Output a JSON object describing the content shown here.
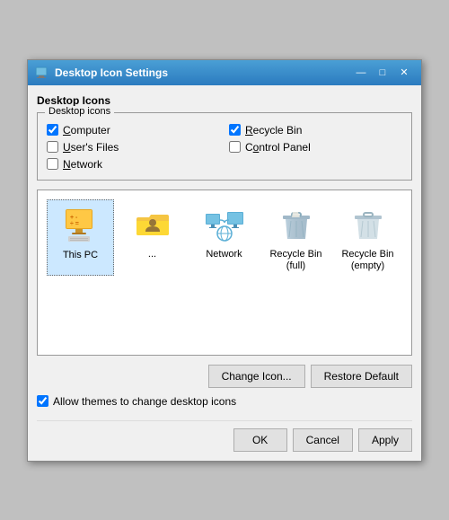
{
  "window": {
    "title": "Desktop Icon Settings",
    "titlebar_icon": "🖥️"
  },
  "section": {
    "label": "Desktop Icons",
    "group_title": "Desktop icons",
    "checkboxes": [
      {
        "id": "cb-computer",
        "label": "Computer",
        "underline_char": "C",
        "checked": true,
        "col": 1
      },
      {
        "id": "cb-recycle",
        "label": "Recycle Bin",
        "underline_char": "R",
        "checked": true,
        "col": 2
      },
      {
        "id": "cb-userfiles",
        "label": "User's Files",
        "underline_char": "U",
        "checked": false,
        "col": 1
      },
      {
        "id": "cb-controlpanel",
        "label": "Control Panel",
        "underline_char": "o",
        "checked": false,
        "col": 2
      },
      {
        "id": "cb-network",
        "label": "Network",
        "underline_char": "N",
        "checked": false,
        "col": 1
      }
    ]
  },
  "icons": [
    {
      "id": "this-pc",
      "label": "This PC",
      "type": "pc",
      "selected": true
    },
    {
      "id": "user-files",
      "label": "...",
      "type": "folder",
      "selected": false
    },
    {
      "id": "network",
      "label": "Network",
      "type": "network",
      "selected": false
    },
    {
      "id": "recycle-full",
      "label": "Recycle Bin\n(full)",
      "type": "recycle-full",
      "selected": false
    },
    {
      "id": "recycle-empty",
      "label": "Recycle Bin\n(empty)",
      "type": "recycle-empty",
      "selected": false
    }
  ],
  "buttons": {
    "change_icon": "Change Icon...",
    "restore_default": "Restore Default"
  },
  "allow_themes": {
    "label": "Allow themes to change desktop icons",
    "checked": true
  },
  "footer": {
    "ok": "OK",
    "cancel": "Cancel",
    "apply": "Apply"
  },
  "titlebar_controls": {
    "minimize": "—",
    "maximize": "□",
    "close": "✕"
  }
}
